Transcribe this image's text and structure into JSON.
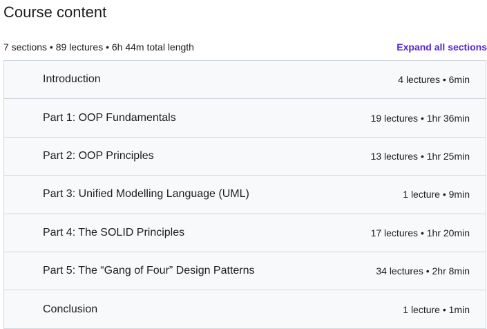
{
  "heading": "Course content",
  "summary": "7 sections • 89 lectures • 6h 44m total length",
  "expand_label": "Expand all sections",
  "sections": [
    {
      "title": "Introduction",
      "meta": "4 lectures • 6min"
    },
    {
      "title": "Part 1: OOP Fundamentals",
      "meta": "19 lectures • 1hr 36min"
    },
    {
      "title": "Part 2: OOP Principles",
      "meta": "13 lectures • 1hr 25min"
    },
    {
      "title": "Part 3: Unified Modelling Language (UML)",
      "meta": "1 lecture • 9min"
    },
    {
      "title": "Part 4: The SOLID Principles",
      "meta": "17 lectures • 1hr 20min"
    },
    {
      "title": "Part 5: The “Gang of Four” Design Patterns",
      "meta": "34 lectures • 2hr 8min"
    },
    {
      "title": "Conclusion",
      "meta": "1 lecture • 1min"
    }
  ],
  "colors": {
    "accent": "#5624d0",
    "section_bg": "#f7f9fa",
    "border": "#d1d7dc",
    "text": "#1c1d1f"
  }
}
